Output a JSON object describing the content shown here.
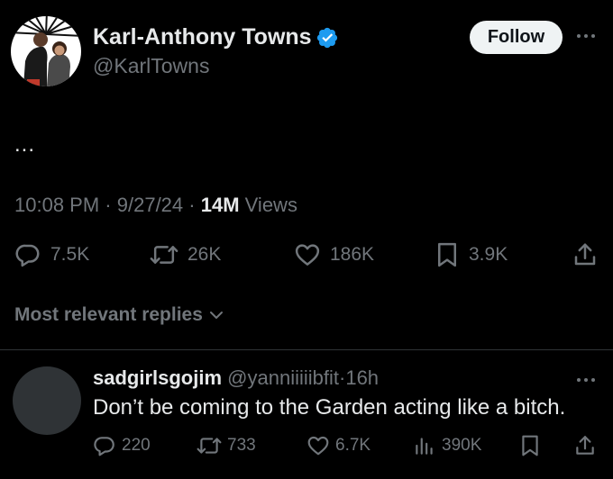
{
  "author": {
    "name": "Karl-Anthony Towns",
    "handle": "@KarlTowns"
  },
  "follow_label": "Follow",
  "tweet": {
    "text": "...",
    "time": "10:08 PM",
    "date": "9/27/24",
    "views_count": "14M",
    "views_label": "Views",
    "separator": "·"
  },
  "actions": {
    "replies": "7.5K",
    "reposts": "26K",
    "likes": "186K",
    "bookmarks": "3.9K"
  },
  "replies_filter": "Most relevant replies",
  "reply": {
    "name": "sadgirlsgojim",
    "handle": "@yanniiiiibfit",
    "time": "16h",
    "text": "Don’t be coming to the Garden acting like a bitch.",
    "replies": "220",
    "reposts": "733",
    "likes": "6.7K",
    "views": "390K"
  },
  "colors": {
    "background": "#000000",
    "text": "#e7e9ea",
    "muted": "#71767b",
    "verified": "#1d9bf0",
    "divider": "#2f3336"
  }
}
